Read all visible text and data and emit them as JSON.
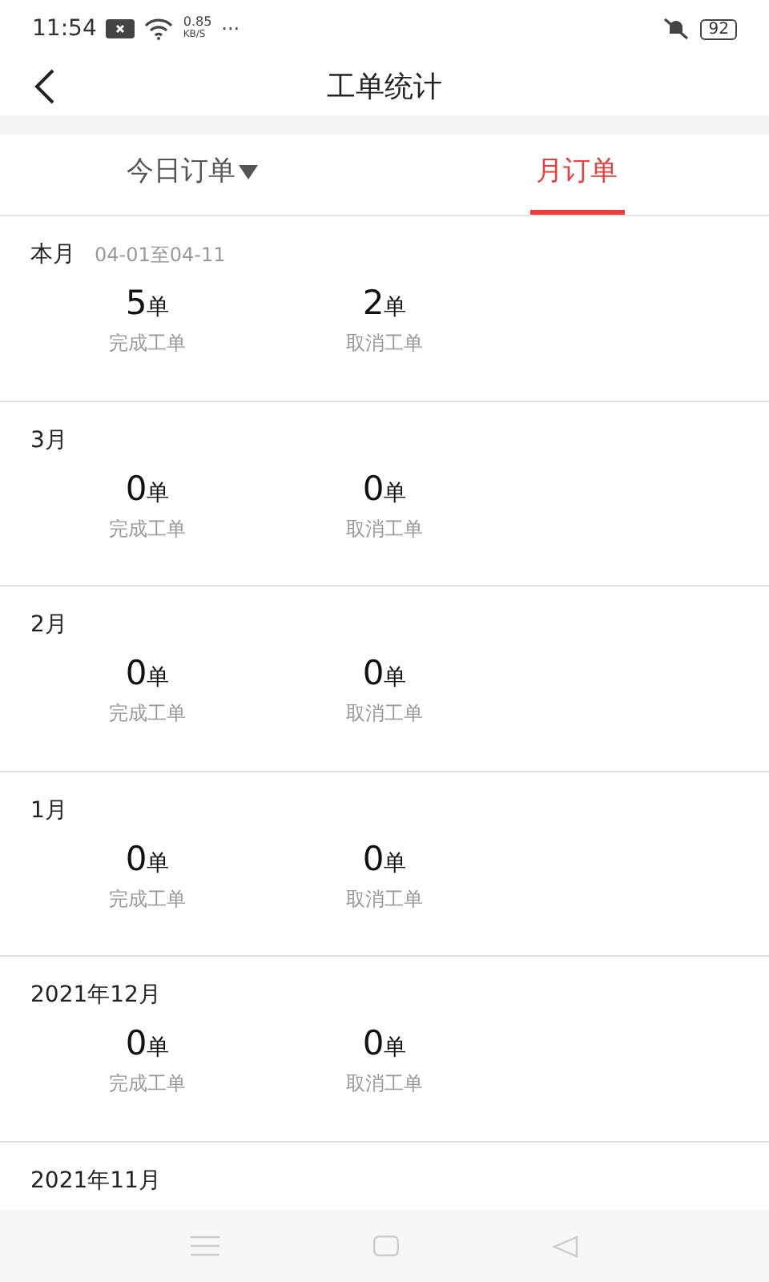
{
  "status_bar": {
    "time": "11:54",
    "speed": "0.85",
    "speed_unit": "KB/S",
    "more": "···",
    "battery": "92"
  },
  "header": {
    "title": "工单统计"
  },
  "tabs": [
    {
      "label": "今日订单",
      "dropdown": true,
      "selected": false
    },
    {
      "label": "月订单",
      "dropdown": false,
      "selected": true
    }
  ],
  "months": [
    {
      "label": "本月",
      "range": "04-01至04-11",
      "stats": [
        {
          "value": "5",
          "unit": "单",
          "label": "完成工单"
        },
        {
          "value": "2",
          "unit": "单",
          "label": "取消工单"
        }
      ]
    },
    {
      "label": "3月",
      "stats": [
        {
          "value": "0",
          "unit": "单",
          "label": "完成工单"
        },
        {
          "value": "0",
          "unit": "单",
          "label": "取消工单"
        }
      ]
    },
    {
      "label": "2月",
      "stats": [
        {
          "value": "0",
          "unit": "单",
          "label": "完成工单"
        },
        {
          "value": "0",
          "unit": "单",
          "label": "取消工单"
        }
      ]
    },
    {
      "label": "1月",
      "stats": [
        {
          "value": "0",
          "unit": "单",
          "label": "完成工单"
        },
        {
          "value": "0",
          "unit": "单",
          "label": "取消工单"
        }
      ]
    },
    {
      "label": "2021年12月",
      "stats": [
        {
          "value": "0",
          "unit": "单",
          "label": "完成工单"
        },
        {
          "value": "0",
          "unit": "单",
          "label": "取消工单"
        }
      ]
    },
    {
      "label": "2021年11月"
    }
  ]
}
